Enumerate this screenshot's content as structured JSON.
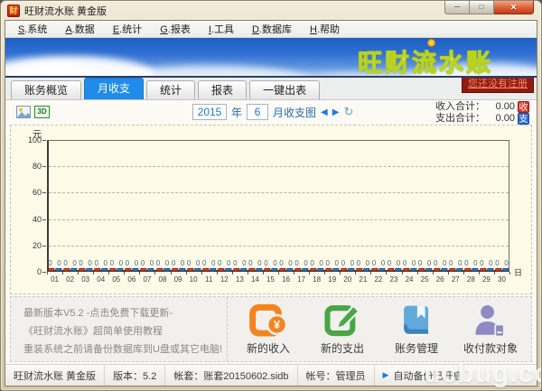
{
  "window": {
    "title": "旺财流水账 黄金版",
    "icon_glyph": "财",
    "controls": {
      "minimize": "─",
      "maximize": "□",
      "close": "✕"
    }
  },
  "menu": {
    "items": [
      {
        "key": "S",
        "label": "系统"
      },
      {
        "key": "A",
        "label": "数据"
      },
      {
        "key": "E",
        "label": "统计"
      },
      {
        "key": "G",
        "label": "报表"
      },
      {
        "key": "I",
        "label": "工具"
      },
      {
        "key": "D",
        "label": "数据库"
      },
      {
        "key": "H",
        "label": "帮助"
      }
    ]
  },
  "banner": {
    "title": "旺财流水账"
  },
  "tabs": [
    {
      "label": "账务概览",
      "active": false
    },
    {
      "label": "月收支",
      "active": true
    },
    {
      "label": "统计",
      "active": false
    },
    {
      "label": "报表",
      "active": false
    },
    {
      "label": "一键出表",
      "active": false
    }
  ],
  "register": {
    "label": "您还没有注册"
  },
  "chart_controls": {
    "year": "2015",
    "year_suffix": "年",
    "month": "6",
    "title_suffix": "月收支图",
    "prev": "◀",
    "next": "▶",
    "refresh": "↻",
    "threed_icon": "3D"
  },
  "totals": {
    "income_label": "收入合计：",
    "income_value": "0.00",
    "income_badge": "收",
    "expense_label": "支出合计：",
    "expense_value": "0.00",
    "expense_badge": "支"
  },
  "chart_data": {
    "type": "bar",
    "title": "2015年6月收支图",
    "ylabel": "元",
    "xlabel": "日",
    "ylim": [
      0,
      100
    ],
    "yticks": [
      0,
      20,
      40,
      60,
      80,
      100
    ],
    "grid": true,
    "legend_position": "none",
    "categories": [
      "01",
      "02",
      "03",
      "04",
      "05",
      "06",
      "07",
      "08",
      "09",
      "10",
      "11",
      "12",
      "13",
      "14",
      "15",
      "16",
      "17",
      "18",
      "19",
      "20",
      "21",
      "22",
      "23",
      "24",
      "25",
      "26",
      "27",
      "28",
      "29",
      "30"
    ],
    "series": [
      {
        "name": "收入",
        "color": "#c0392b",
        "values": [
          0,
          0,
          0,
          0,
          0,
          0,
          0,
          0,
          0,
          0,
          0,
          0,
          0,
          0,
          0,
          0,
          0,
          0,
          0,
          0,
          0,
          0,
          0,
          0,
          0,
          0,
          0,
          0,
          0,
          0
        ]
      },
      {
        "name": "支出",
        "color": "#2e6da4",
        "values": [
          0,
          0,
          0,
          0,
          0,
          0,
          0,
          0,
          0,
          0,
          0,
          0,
          0,
          0,
          0,
          0,
          0,
          0,
          0,
          0,
          0,
          0,
          0,
          0,
          0,
          0,
          0,
          0,
          0,
          0
        ]
      }
    ]
  },
  "notices": [
    "最新版本V5.2  -点击免费下载更新-",
    "《旺财流水账》超简单使用教程",
    "重装系统之前请备份数据库到U盘或其它电脑!"
  ],
  "actions": [
    {
      "label": "新的收入",
      "icon": "income-icon"
    },
    {
      "label": "新的支出",
      "icon": "expense-icon"
    },
    {
      "label": "账务管理",
      "icon": "ledger-icon"
    },
    {
      "label": "收付款对象",
      "icon": "payee-icon"
    }
  ],
  "statusbar": {
    "segments": [
      {
        "text": "旺财流水账 黄金版"
      },
      {
        "text": "版本：5.2"
      },
      {
        "text": "帐套：账套20150602.sidb"
      },
      {
        "text": "帐号：管理员"
      },
      {
        "text": "自动备份已开启",
        "arrow": "▶"
      }
    ]
  },
  "watermark": "ucbug.cc"
}
